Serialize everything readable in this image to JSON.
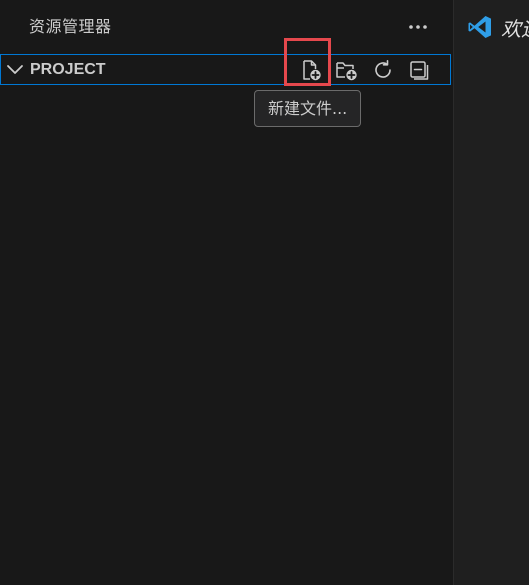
{
  "explorer": {
    "title": "资源管理器",
    "more_actions_icon": "ellipsis-icon"
  },
  "project": {
    "label": "PROJECT",
    "expanded": true,
    "actions": [
      {
        "name": "new-file",
        "icon": "new-file-icon",
        "highlighted": true
      },
      {
        "name": "new-folder",
        "icon": "new-folder-icon"
      },
      {
        "name": "refresh",
        "icon": "refresh-icon"
      },
      {
        "name": "collapse-all",
        "icon": "collapse-all-icon"
      }
    ]
  },
  "tooltip": {
    "text": "新建文件..."
  },
  "editor": {
    "tab_label": "欢迎",
    "logo_icon": "vscode-logo-icon"
  },
  "colors": {
    "focus_border": "#0078d4",
    "highlight": "#e5484d",
    "vscode_blue": "#2f9ee8"
  }
}
